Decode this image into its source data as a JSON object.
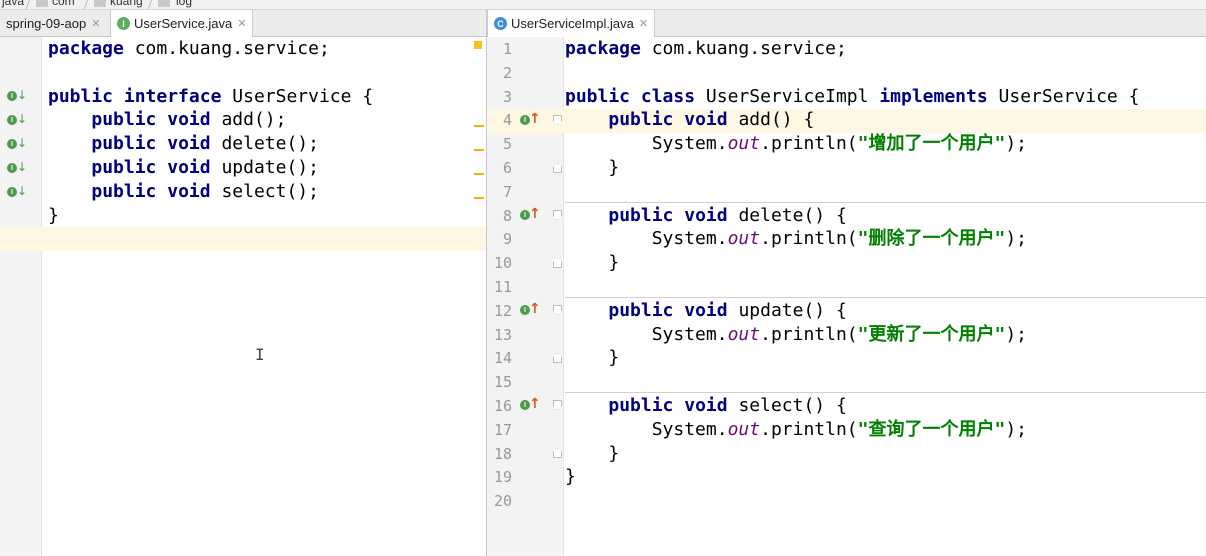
{
  "breadcrumb": [
    "java",
    "com",
    "kuang",
    "log"
  ],
  "left_editor": {
    "tab": {
      "label": "UserService.java",
      "icon": "interface-icon"
    },
    "prev_tab": {
      "label": "spring-09-aop"
    },
    "lines": [
      "package com.kuang.service;",
      "",
      "public interface UserService {",
      "    public void add();",
      "    public void delete();",
      "    public void update();",
      "    public void select();",
      "}"
    ]
  },
  "right_editor": {
    "tab": {
      "label": "UserServiceImpl.java",
      "icon": "class-icon"
    },
    "line_numbers": [
      "1",
      "2",
      "3",
      "4",
      "5",
      "6",
      "7",
      "8",
      "9",
      "10",
      "11",
      "12",
      "13",
      "14",
      "15",
      "16",
      "17",
      "18",
      "19",
      "20"
    ],
    "lines": [
      "package com.kuang.service;",
      "",
      "public class UserServiceImpl implements UserService {",
      "    public void add() {",
      "        System.out.println(\"增加了一个用户\");",
      "    }",
      "",
      "    public void delete() {",
      "        System.out.println(\"删除了一个用户\");",
      "    }",
      "",
      "    public void update() {",
      "        System.out.println(\"更新了一个用户\");",
      "    }",
      "",
      "    public void select() {",
      "        System.out.println(\"查询了一个用户\");",
      "    }",
      "}",
      ""
    ]
  },
  "colors": {
    "keyword": "#000080",
    "string": "#008000",
    "static_field": "#660e7a",
    "current_line": "#fdf7e4",
    "gutter": "#f3f3f3"
  }
}
